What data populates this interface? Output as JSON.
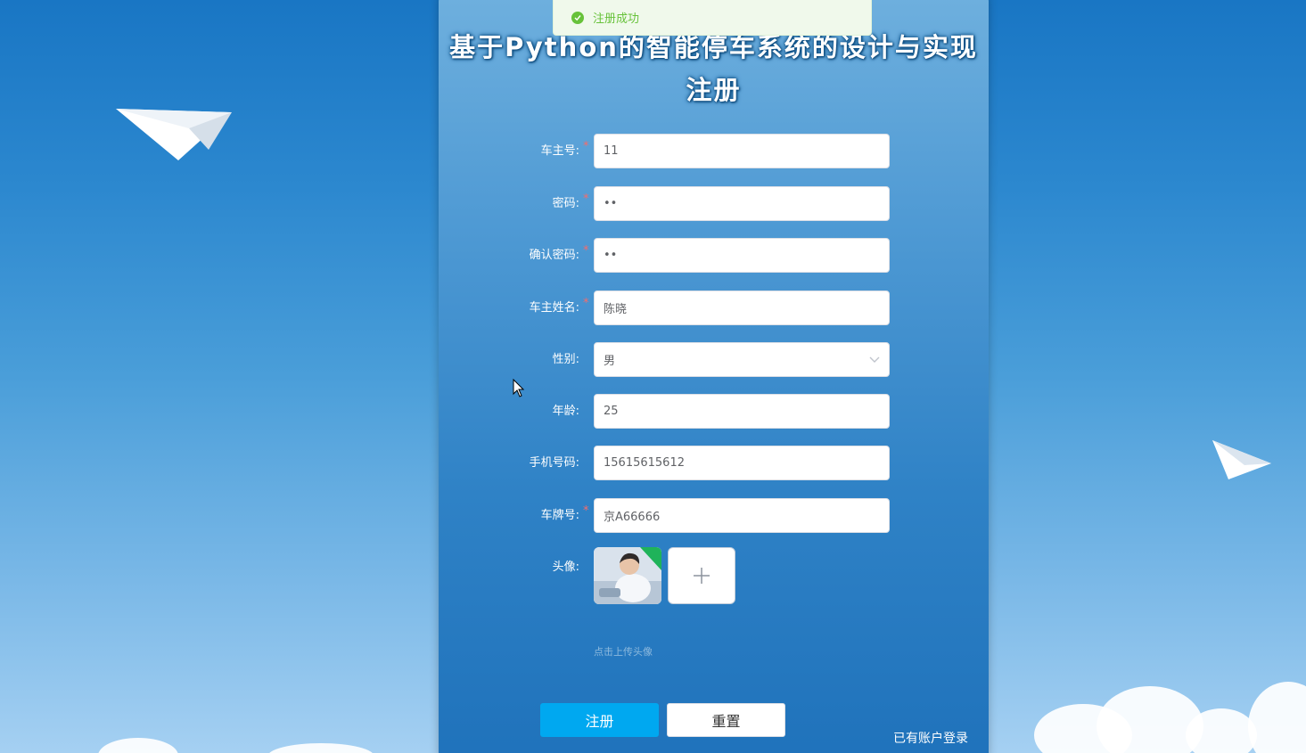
{
  "toast": {
    "icon": "check-circle-icon",
    "message": "注册成功"
  },
  "title": {
    "main": "基于Python的智能停车系统的设计与实现",
    "sub": "注册"
  },
  "form": {
    "owner_no": {
      "label": "车主号:",
      "value": "11",
      "required": true
    },
    "password": {
      "label": "密码:",
      "value": "••",
      "required": true
    },
    "confirm_password": {
      "label": "确认密码:",
      "value": "••",
      "required": true
    },
    "owner_name": {
      "label": "车主姓名:",
      "value": "陈晓",
      "required": true
    },
    "gender": {
      "label": "性别:",
      "value": "男",
      "icon": "chevron-down-icon"
    },
    "age": {
      "label": "年龄:",
      "value": "25"
    },
    "phone": {
      "label": "手机号码:",
      "value": "15615615612"
    },
    "plate": {
      "label": "车牌号:",
      "value": "京A66666",
      "required": true
    },
    "avatar": {
      "label": "头像:",
      "upload_icon": "plus-icon",
      "tip": "点击上传头像"
    }
  },
  "required_mark": "*",
  "buttons": {
    "register": "注册",
    "reset": "重置"
  },
  "login_link": "已有账户登录",
  "colors": {
    "primary": "#00a8f0",
    "success": "#67c23a",
    "required": "#f56c6c",
    "panel": "#2f82c6"
  }
}
